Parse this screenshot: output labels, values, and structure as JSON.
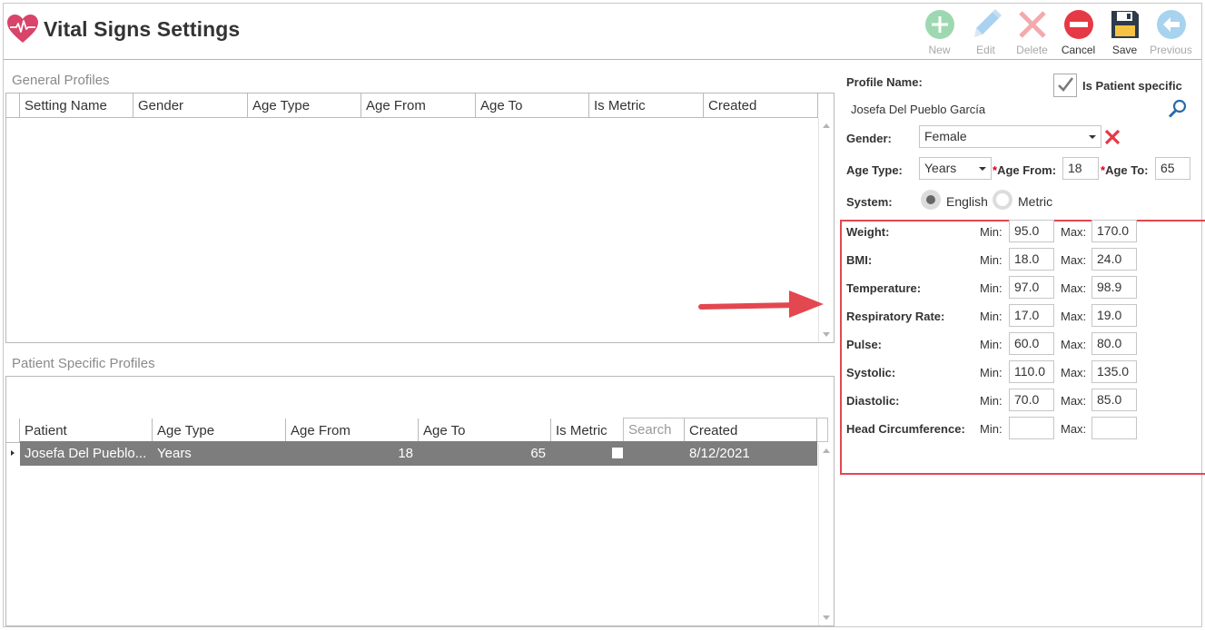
{
  "app": {
    "title": "Vital Signs Settings"
  },
  "toolbar": {
    "new": "New",
    "edit": "Edit",
    "delete": "Delete",
    "cancel": "Cancel",
    "save": "Save",
    "previous": "Previous"
  },
  "general_profiles": {
    "title": "General Profiles",
    "columns": [
      "Setting Name",
      "Gender",
      "Age Type",
      "Age From",
      "Age To",
      "Is Metric",
      "Created"
    ]
  },
  "patient_profiles": {
    "title": "Patient Specific Profiles",
    "search_placeholder": "Search",
    "columns": [
      "Patient",
      "Age Type",
      "Age From",
      "Age To",
      "Is Metric",
      "Created"
    ],
    "rows": [
      {
        "patient": "Josefa Del Pueblo...",
        "age_type": "Years",
        "age_from": "18",
        "age_to": "65",
        "is_metric": false,
        "created": "8/12/2021"
      }
    ]
  },
  "form": {
    "profile_name_label": "Profile Name:",
    "is_patient_specific_label": "Is Patient specific",
    "is_patient_specific": true,
    "profile_name_value": "Josefa Del Pueblo García",
    "gender_label": "Gender:",
    "gender_value": "Female",
    "age_type_label": "Age Type:",
    "age_type_value": "Years",
    "age_from_label": "Age From:",
    "age_from_value": "18",
    "age_to_label": "Age To:",
    "age_to_value": "65",
    "required_mark": "*",
    "system_label": "System:",
    "system_english": "English",
    "system_metric": "Metric",
    "system_selected": "English",
    "min_label": "Min:",
    "max_label": "Max:",
    "vitals": [
      {
        "label": "Weight:",
        "min": "95.0",
        "max": "170.0"
      },
      {
        "label": "BMI:",
        "min": "18.0",
        "max": "24.0"
      },
      {
        "label": "Temperature:",
        "min": "97.0",
        "max": "98.9"
      },
      {
        "label": "Respiratory Rate:",
        "min": "17.0",
        "max": "19.0"
      },
      {
        "label": "Pulse:",
        "min": "60.0",
        "max": "80.0"
      },
      {
        "label": "Systolic:",
        "min": "110.0",
        "max": "135.0"
      },
      {
        "label": "Diastolic:",
        "min": "70.0",
        "max": "85.0"
      },
      {
        "label": "Head Circumference:",
        "min": "",
        "max": ""
      }
    ]
  },
  "colors": {
    "accent_red": "#e3474f",
    "selected_row": "#7d7d7d",
    "new_green": "#9ed8b0",
    "edit_blue": "#a9d2f0",
    "delete_red": "#f4a9ad",
    "cancel_red": "#e53945",
    "save_navy": "#2d3a4a",
    "previous_blue": "#a7d3ef"
  }
}
